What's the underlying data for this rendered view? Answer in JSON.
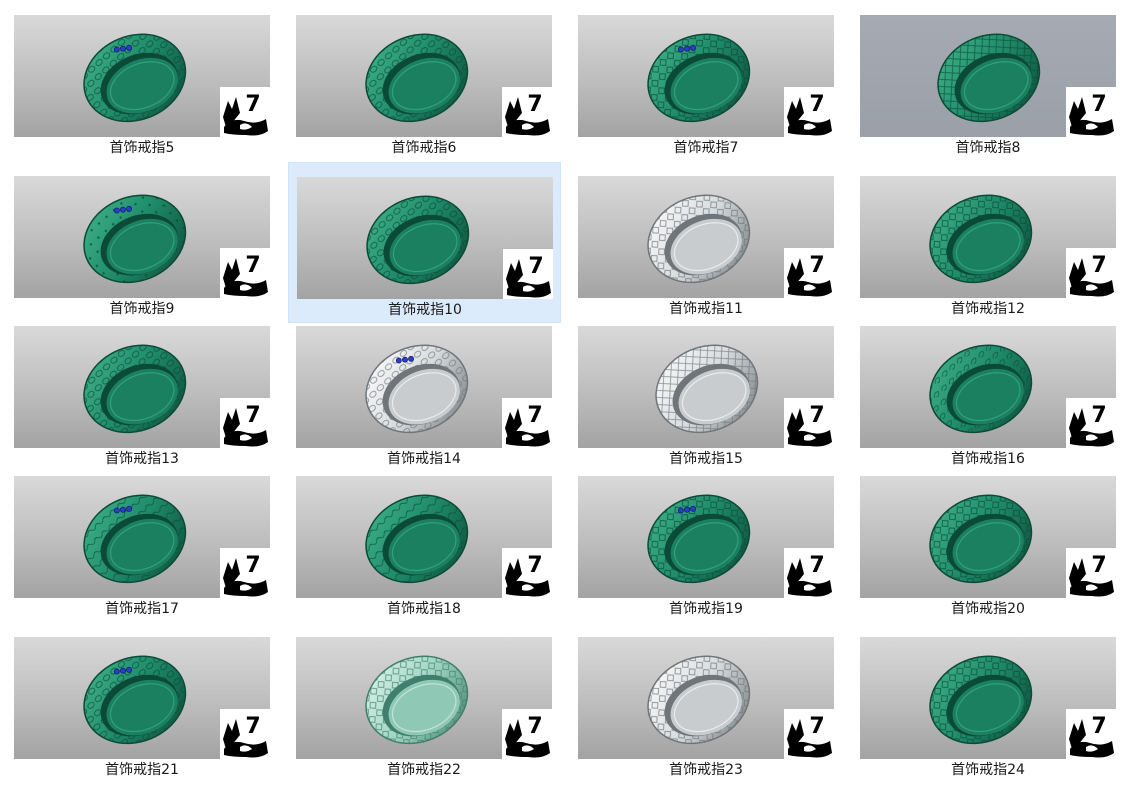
{
  "items": [
    {
      "label": "首饰戒指5",
      "color": "green",
      "pattern": "ovals",
      "gems": true,
      "bg": "light"
    },
    {
      "label": "首饰戒指6",
      "color": "green",
      "pattern": "ovals",
      "gems": false,
      "bg": "light"
    },
    {
      "label": "首饰戒指7",
      "color": "green",
      "pattern": "diamonds",
      "gems": true,
      "bg": "light"
    },
    {
      "label": "首饰戒指8",
      "color": "green",
      "pattern": "lattice",
      "gems": false,
      "bg": "gray"
    },
    {
      "label": "首饰戒指9",
      "color": "green",
      "pattern": "dots",
      "gems": true,
      "bg": "light"
    },
    {
      "label": "首饰戒指10",
      "color": "green",
      "pattern": "ovals",
      "gems": false,
      "bg": "light",
      "selected": true
    },
    {
      "label": "首饰戒指11",
      "color": "silver",
      "pattern": "diamonds",
      "gems": false,
      "bg": "light"
    },
    {
      "label": "首饰戒指12",
      "color": "green",
      "pattern": "diamonds",
      "gems": false,
      "bg": "light"
    },
    {
      "label": "首饰戒指13",
      "color": "green",
      "pattern": "ovals",
      "gems": false,
      "bg": "light"
    },
    {
      "label": "首饰戒指14",
      "color": "silver",
      "pattern": "ovals",
      "gems": true,
      "bg": "light"
    },
    {
      "label": "首饰戒指15",
      "color": "silver",
      "pattern": "lattice",
      "gems": false,
      "bg": "light"
    },
    {
      "label": "首饰戒指16",
      "color": "green",
      "pattern": "swirls",
      "gems": false,
      "bg": "light"
    },
    {
      "label": "首饰戒指17",
      "color": "green",
      "pattern": "waves",
      "gems": true,
      "bg": "light"
    },
    {
      "label": "首饰戒指18",
      "color": "green",
      "pattern": "waves",
      "gems": false,
      "bg": "light"
    },
    {
      "label": "首饰戒指19",
      "color": "green",
      "pattern": "diamonds",
      "gems": true,
      "bg": "light"
    },
    {
      "label": "首饰戒指20",
      "color": "green",
      "pattern": "diamonds",
      "gems": false,
      "bg": "light"
    },
    {
      "label": "首饰戒指21",
      "color": "green",
      "pattern": "ovals",
      "gems": true,
      "bg": "light"
    },
    {
      "label": "首饰戒指22",
      "color": "mint",
      "pattern": "diamonds",
      "gems": false,
      "bg": "light"
    },
    {
      "label": "首饰戒指23",
      "color": "silver",
      "pattern": "diamonds",
      "gems": false,
      "bg": "light"
    },
    {
      "label": "首饰戒指24",
      "color": "green",
      "pattern": "diamonds",
      "gems": false,
      "bg": "light"
    }
  ],
  "badge": {
    "text": "7",
    "icon": "rhino-logo-icon"
  },
  "colors": {
    "green": {
      "base": "#1e8a67",
      "dark": "#0b4a36",
      "light": "#43b68f"
    },
    "silver": {
      "base": "#d8dcde",
      "dark": "#6f7579",
      "light": "#ffffff"
    },
    "mint": {
      "base": "#9ed5c2",
      "dark": "#3f7f6b",
      "light": "#e4f6ef"
    },
    "gem": "#2a3ec8",
    "selection": "#dcebfc"
  }
}
